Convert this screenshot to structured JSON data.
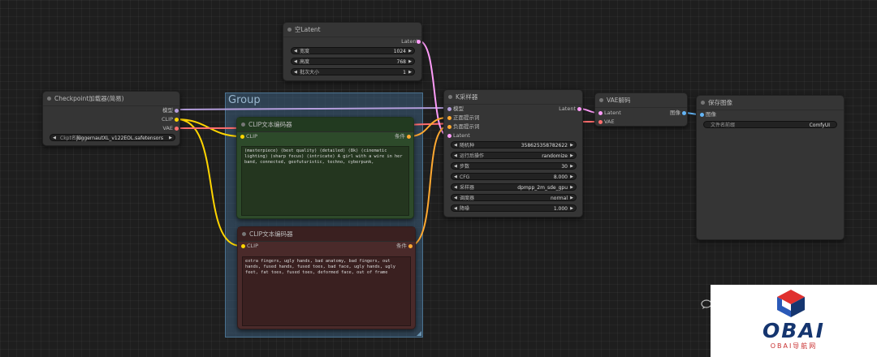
{
  "group": {
    "title": "Group"
  },
  "empty_latent": {
    "title": "空Latent",
    "output": "Latent",
    "widgets": [
      {
        "label": "宽度",
        "value": "1024"
      },
      {
        "label": "高度",
        "value": "768"
      },
      {
        "label": "批次大小",
        "value": "1"
      }
    ]
  },
  "checkpoint": {
    "title": "Checkpoint加载器(简易)",
    "outputs": [
      "模型",
      "CLIP",
      "VAE"
    ],
    "widget_label": "Ckpt名称",
    "widget_value": "juggernautXL_v122EOL.safetensors"
  },
  "clip_positive": {
    "title": "CLIP文本编码器",
    "input": "CLIP",
    "output": "条件",
    "text": "(masterpiece) (best quality) (detailed) (8k) (cinematic lighting) (sharp focus) (intricate) A girl with a wire in her band, connected, geofuturistic, techno, cyberpunk,"
  },
  "clip_negative": {
    "title": "CLIP文本编码器",
    "input": "CLIP",
    "output": "条件",
    "text": "extra fingers, ugly hands, bad anatomy, bad fingers, out hands, fused hands, fused toes, bad face, ugly hands, ugly feet, fat toes, fused toes, deformed face, out of frame"
  },
  "ksampler": {
    "title": "K采样器",
    "inputs": [
      "模型",
      "正面提示词",
      "负面提示词",
      "Latent"
    ],
    "output": "Latent",
    "widgets": [
      {
        "label": "随机种",
        "value": "358625358782622"
      },
      {
        "label": "运行后操作",
        "value": "randomize"
      },
      {
        "label": "步数",
        "value": "30"
      },
      {
        "label": "CFG",
        "value": "8.000"
      },
      {
        "label": "采样器",
        "value": "dpmpp_2m_sde_gpu"
      },
      {
        "label": "调度器",
        "value": "normal"
      },
      {
        "label": "降噪",
        "value": "1.000"
      }
    ]
  },
  "vae_decode": {
    "title": "VAE解码",
    "inputs": [
      "Latent",
      "VAE"
    ],
    "output": "图像"
  },
  "save_image": {
    "title": "保存图像",
    "input": "图像",
    "widget_label": "文件名前缀",
    "widget_value": "ComfyUI"
  },
  "watermark": {
    "brand": "OBAI",
    "sub": "OBAI导航网"
  },
  "colors": {
    "model": "#b39ddb",
    "clip": "#ffd500",
    "vae": "#ff6e6e",
    "latent": "#ff9cf9",
    "conditioning": "#ffa931",
    "image": "#64b5f6",
    "positive_bg": "#2d4a2a",
    "negative_bg": "#4a2a2a"
  }
}
